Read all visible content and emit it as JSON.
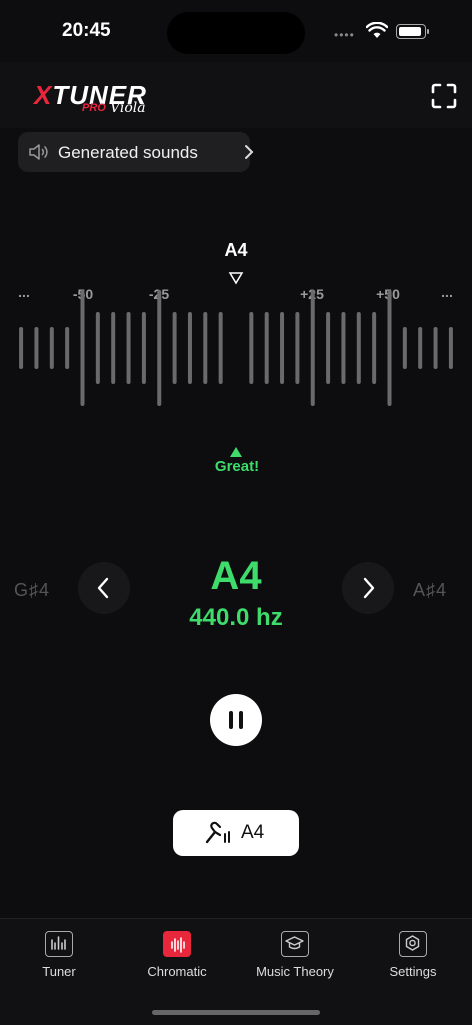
{
  "status_bar": {
    "time": "20:45"
  },
  "header": {
    "logo_main": "TUNER",
    "logo_x": "X",
    "logo_pro": "PRO",
    "logo_sub": "Viola"
  },
  "sounds_button": {
    "label": "Generated sounds"
  },
  "meter": {
    "target_note": "A4",
    "cents_labels": [
      "...",
      "-50",
      "-25",
      "+25",
      "+50",
      "..."
    ],
    "status": "Great!",
    "cents_offset": 0,
    "colors": {
      "accent": "#3ddc6b",
      "ticks": "#6a6a6a"
    }
  },
  "note_display": {
    "prev_note": "G♯4",
    "next_note": "A♯4",
    "current_note": "A4",
    "frequency": "440.0 hz"
  },
  "reference_button": {
    "label": "A4"
  },
  "tabs": [
    {
      "label": "Tuner",
      "icon": "tuner-icon",
      "active": false
    },
    {
      "label": "Chromatic",
      "icon": "chromatic-icon",
      "active": true
    },
    {
      "label": "Music Theory",
      "icon": "graduation-cap-icon",
      "active": false
    },
    {
      "label": "Settings",
      "icon": "gear-icon",
      "active": false
    }
  ],
  "colors": {
    "brand": "#e8263c",
    "accent": "#3ddc6b",
    "background": "#0d0d0f"
  }
}
